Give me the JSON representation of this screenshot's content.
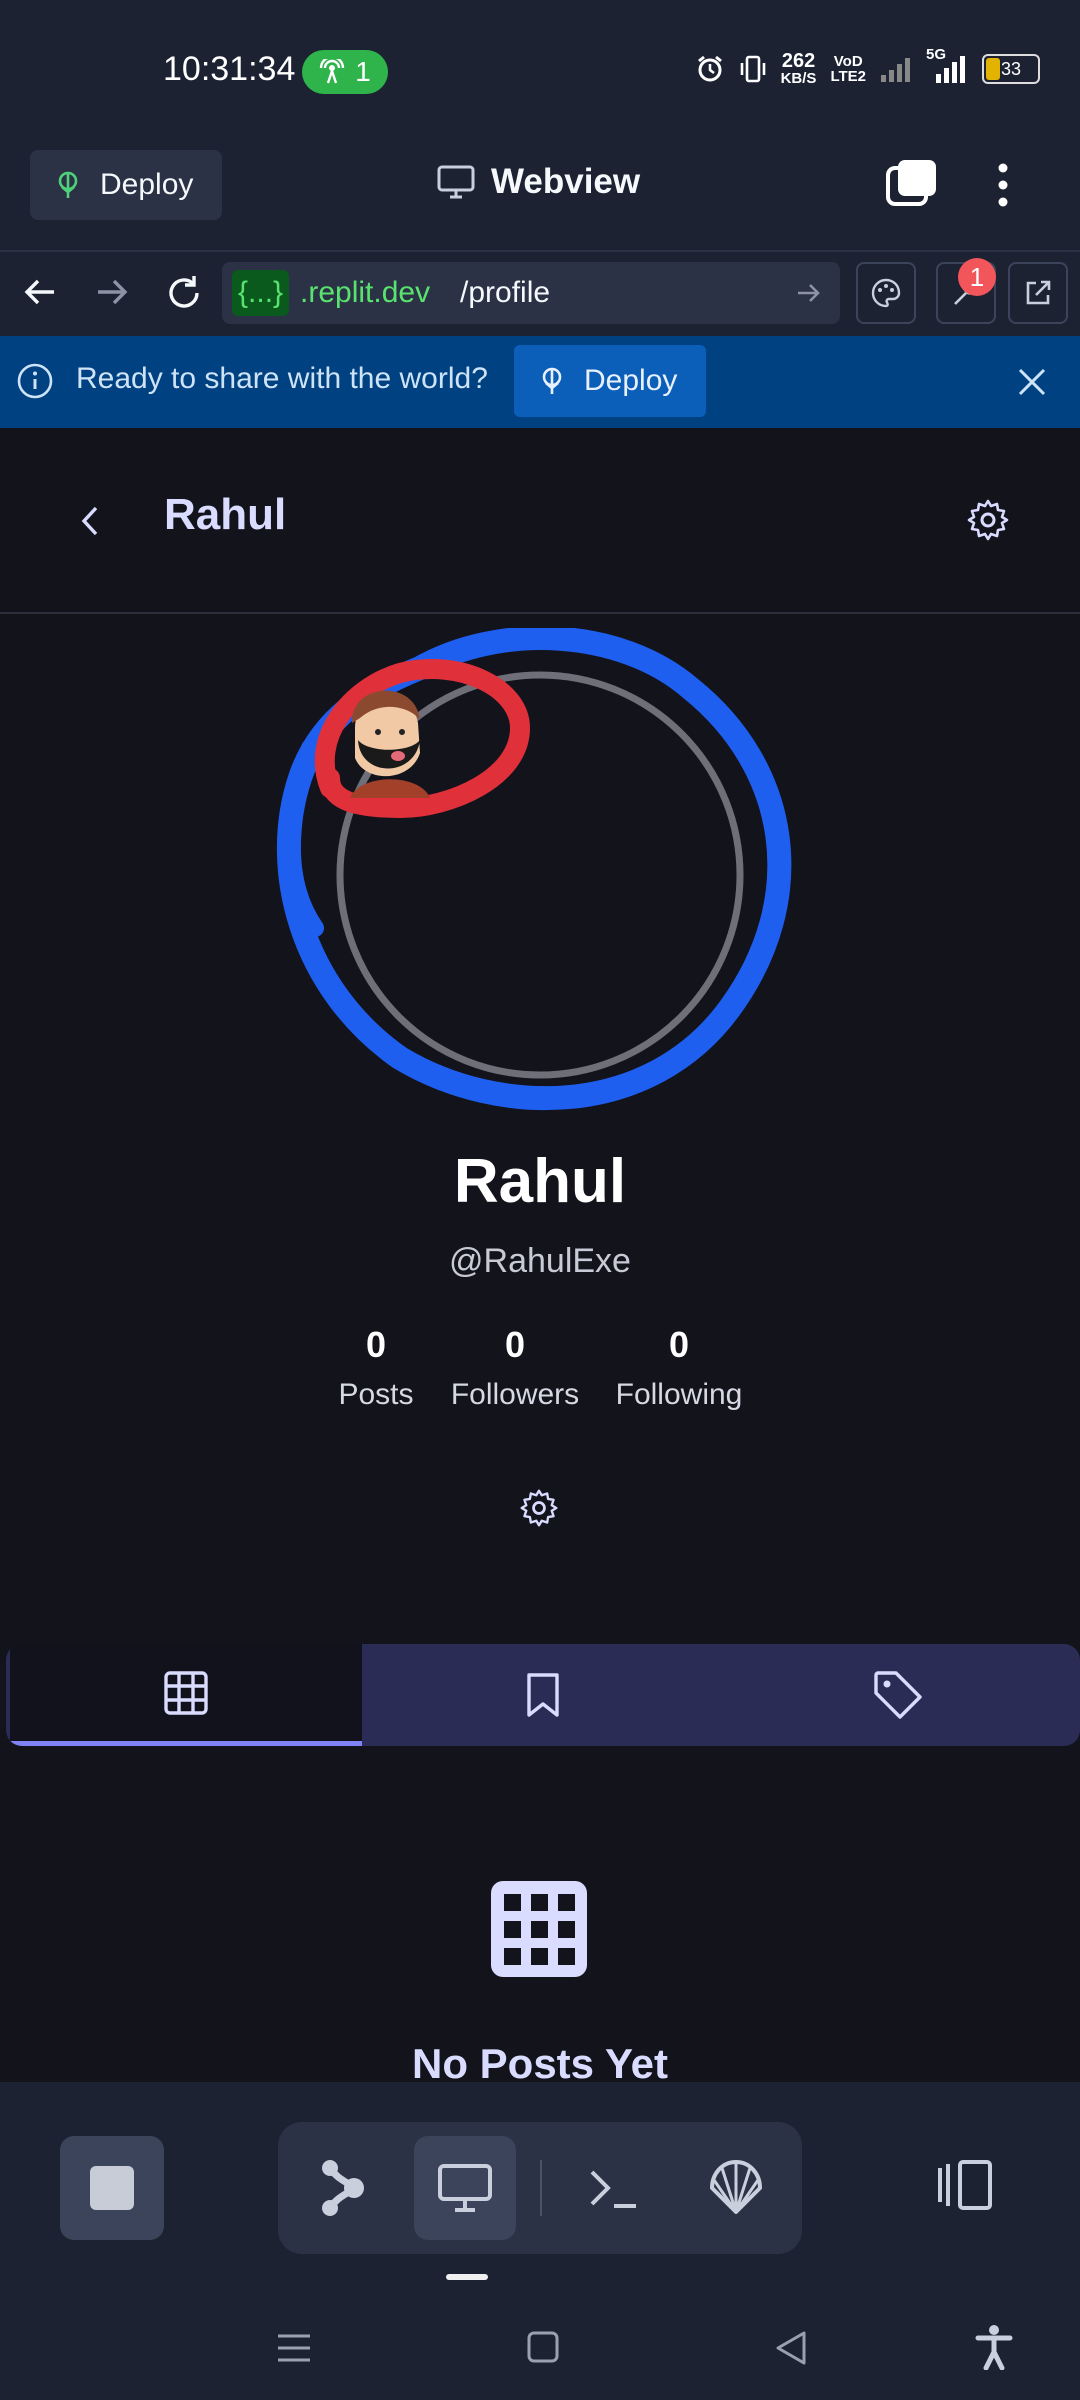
{
  "status_bar": {
    "time": "10:31:34",
    "hotspot_count": "1",
    "net_speed_top": "262",
    "net_speed_bottom": "KB/S",
    "volte_top": "VoD",
    "volte_bottom": "LTE2",
    "network": "5G",
    "battery": "33",
    "icons": [
      "hotspot-icon",
      "alarm-icon",
      "vibrate-icon",
      "signal-icon",
      "battery-icon"
    ]
  },
  "topbar": {
    "deploy_label": "Deploy",
    "title": "Webview"
  },
  "urlbar": {
    "chip": "{...}",
    "host": ".replit.dev",
    "path": "/profile",
    "badge": "1"
  },
  "banner": {
    "text": "Ready to share with the world?",
    "deploy_label": "Deploy"
  },
  "profile": {
    "header_name": "Rahul",
    "name": "Rahul",
    "handle": "@RahulExe",
    "stats": [
      {
        "value": "0",
        "label": "Posts"
      },
      {
        "value": "0",
        "label": "Followers"
      },
      {
        "value": "0",
        "label": "Following"
      }
    ],
    "tabs": [
      "grid-icon",
      "bookmark-icon",
      "tag-icon"
    ],
    "empty_title": "No Posts Yet"
  },
  "colors": {
    "replit_bg": "#1c2232",
    "app_bg": "#13131c",
    "banner_bg": "#004182",
    "accent": "#7f83f3",
    "url_green": "#58e36e",
    "annotation_blue": "#1f5ff0",
    "annotation_red": "#e0303a"
  }
}
